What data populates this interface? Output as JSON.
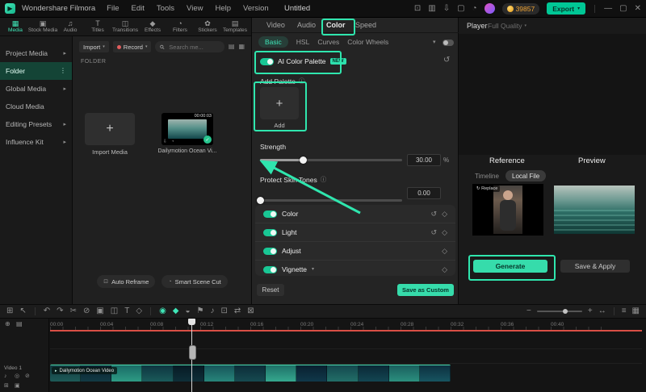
{
  "menubar": {
    "app": "Wondershare Filmora",
    "menus": [
      "File",
      "Edit",
      "Tools",
      "View",
      "Help",
      "Version"
    ],
    "title": "Untitled",
    "coin_count": "39857",
    "export_label": "Export",
    "window": {
      "min": "—",
      "max": "▢",
      "close": "✕"
    },
    "right_icons": [
      {
        "name": "gift-icon",
        "g": "⊡"
      },
      {
        "name": "layout-icon",
        "g": "▥"
      },
      {
        "name": "download-icon",
        "g": "⇩"
      },
      {
        "name": "screen-record-icon",
        "g": "▢"
      },
      {
        "name": "notifications-icon",
        "g": "◔"
      }
    ]
  },
  "ribbon": {
    "tabs": [
      {
        "label": "Media",
        "g": "▦"
      },
      {
        "label": "Stock Media",
        "g": "▣"
      },
      {
        "label": "Audio",
        "g": "♫"
      },
      {
        "label": "Titles",
        "g": "T"
      },
      {
        "label": "Transitions",
        "g": "◫"
      },
      {
        "label": "Effects",
        "g": "◆"
      },
      {
        "label": "Filters",
        "g": "◔"
      },
      {
        "label": "Stickers",
        "g": "✿"
      },
      {
        "label": "Templates",
        "g": "▤"
      }
    ]
  },
  "sidebar": {
    "items": [
      {
        "label": "Project Media",
        "trail": "▸"
      },
      {
        "label": "Folder",
        "trail": "⋮"
      },
      {
        "label": "Global Media",
        "trail": "▸"
      },
      {
        "label": "Cloud Media",
        "trail": ""
      },
      {
        "label": "Editing Presets",
        "trail": "▸"
      },
      {
        "label": "Influence Kit",
        "trail": "▸"
      }
    ]
  },
  "media": {
    "import_btn": "Import",
    "record_btn": "Record",
    "search_placeholder": "Search me...",
    "folder_label": "FOLDER",
    "import_card": {
      "plus": "+",
      "label": "Import Media"
    },
    "clip_card": {
      "duration": "00:00:03",
      "label": "Dailymotion Ocean Vi...",
      "check": "✓"
    },
    "footer": [
      {
        "label": "Auto Reframe",
        "g": "⊡"
      },
      {
        "label": "Smart Scene Cut",
        "g": "◔"
      }
    ]
  },
  "properties": {
    "tabs": [
      "Video",
      "Audio",
      "Color",
      "Speed"
    ],
    "subtabs": [
      "Basic",
      "HSL",
      "Curves",
      "Color Wheels"
    ],
    "ai_palette": {
      "label": "AI Color Palette",
      "badge": "NEW",
      "reset": "↺"
    },
    "add_palette": {
      "label": "Add Palette",
      "info": "ⓘ",
      "card_plus": "+",
      "card_label": "Add"
    },
    "strength": {
      "label": "Strength",
      "value": "30.00",
      "unit": "%",
      "percent": 30
    },
    "skin": {
      "label": "Protect Skin Tones",
      "info": "ⓘ",
      "value": "0.00",
      "percent": 0
    },
    "toggles": [
      {
        "label": "Color",
        "reset": "↺",
        "key": "◇"
      },
      {
        "label": "Light",
        "reset": "↺",
        "key": "◇"
      },
      {
        "label": "Adjust",
        "key": "◇"
      },
      {
        "label": "Vignette",
        "expand": "▾",
        "key": "◇"
      }
    ],
    "reset_btn": "Reset",
    "save_btn": "Save as Custom"
  },
  "player": {
    "label": "Player",
    "quality": "Full Quality",
    "reference": "Reference",
    "preview": "Preview",
    "tabs": [
      "Timeline",
      "Local File"
    ],
    "replace": "↻ Replace",
    "generate": "Generate",
    "save_apply": "Save & Apply"
  },
  "timeline_toolbar": {
    "left": [
      {
        "name": "workspace-icon",
        "g": "⊞"
      },
      {
        "name": "pointer-icon",
        "g": "↖"
      }
    ],
    "edit": [
      {
        "name": "undo-icon",
        "g": "↶"
      },
      {
        "name": "redo-icon",
        "g": "↷"
      },
      {
        "name": "split-icon",
        "g": "✂"
      },
      {
        "name": "delete-icon",
        "g": "⊘"
      },
      {
        "name": "crop-icon",
        "g": "▣"
      },
      {
        "name": "transition-icon",
        "g": "◫"
      },
      {
        "name": "text-icon",
        "g": "T"
      },
      {
        "name": "keyframe-icon",
        "g": "◇"
      }
    ],
    "tools": [
      {
        "name": "color-match-icon",
        "g": "◉"
      },
      {
        "name": "ai-color-icon",
        "g": "◆"
      },
      {
        "name": "mask-icon",
        "g": "◒"
      },
      {
        "name": "marker-icon",
        "g": "⚑"
      },
      {
        "name": "voiceover-icon",
        "g": "♪"
      },
      {
        "name": "snapshot-icon",
        "g": "⊡"
      },
      {
        "name": "render-icon",
        "g": "⇄"
      },
      {
        "name": "export-frame-icon",
        "g": "⊠"
      }
    ],
    "zoom": {
      "minus": "−",
      "plus": "+",
      "fit": "↔"
    },
    "view": [
      {
        "name": "track-list-icon",
        "g": "≡"
      },
      {
        "name": "track-grid-icon",
        "g": "▦"
      }
    ]
  },
  "timeline": {
    "ruler": [
      "00:00",
      "00:04",
      "00:08",
      "00:12",
      "00:16",
      "00:20",
      "00:24",
      "00:28",
      "00:32",
      "00:36",
      "00:40"
    ],
    "track_label": "Video 1",
    "clip_label": "Dailymotion Ocean Video"
  }
}
